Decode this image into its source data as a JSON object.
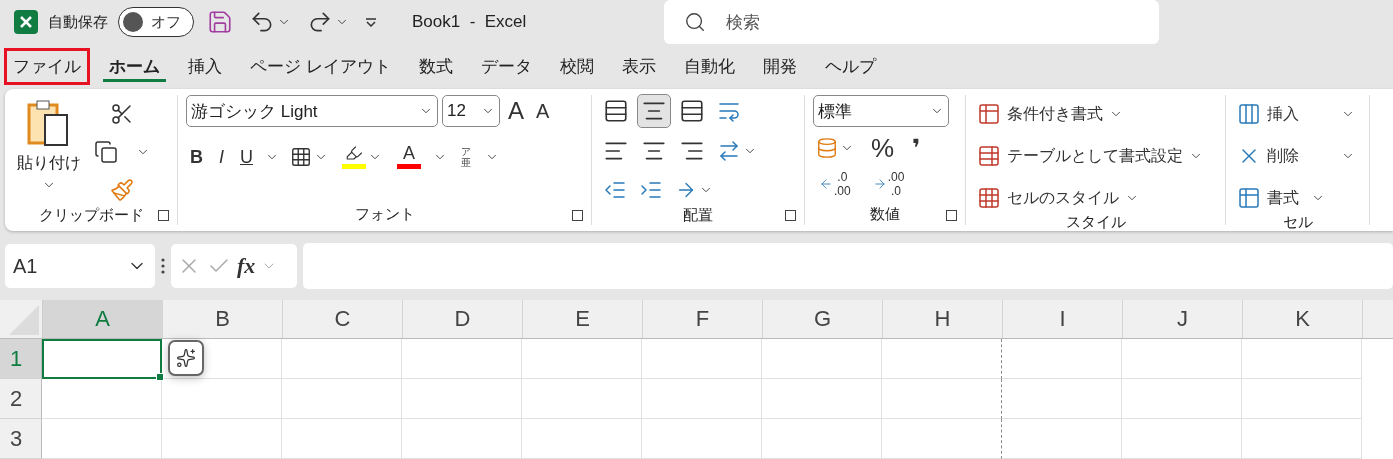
{
  "title_bar": {
    "autosave": {
      "label": "自動保存",
      "on": false,
      "state_label": "オフ"
    },
    "title": "Book1  -  Excel",
    "search": {
      "placeholder": "検索"
    }
  },
  "tabs": [
    {
      "label": "ファイル",
      "selected": false,
      "highlighted": true
    },
    {
      "label": "ホーム",
      "selected": true,
      "highlighted": false
    },
    {
      "label": "挿入",
      "selected": false,
      "highlighted": false
    },
    {
      "label": "ページ レイアウト",
      "selected": false,
      "highlighted": false
    },
    {
      "label": "数式",
      "selected": false,
      "highlighted": false
    },
    {
      "label": "データ",
      "selected": false,
      "highlighted": false
    },
    {
      "label": "校閲",
      "selected": false,
      "highlighted": false
    },
    {
      "label": "表示",
      "selected": false,
      "highlighted": false
    },
    {
      "label": "自動化",
      "selected": false,
      "highlighted": false
    },
    {
      "label": "開発",
      "selected": false,
      "highlighted": false
    },
    {
      "label": "ヘルプ",
      "selected": false,
      "highlighted": false
    }
  ],
  "ribbon": {
    "clipboard": {
      "label": "クリップボード",
      "paste_label": "貼り付け"
    },
    "font": {
      "label": "フォント",
      "font_name": "游ゴシック Light",
      "font_size": "12",
      "grow": "A",
      "shrink": "A",
      "bold": "B",
      "italic": "I",
      "underline": "U",
      "font_color_glyph": "A",
      "phonetic_top": "ア",
      "phonetic_bottom": "亜"
    },
    "alignment": {
      "label": "配置",
      "vertical": [
        {
          "kind": "top",
          "selected": false
        },
        {
          "kind": "middle",
          "selected": true
        },
        {
          "kind": "bottom",
          "selected": false
        }
      ],
      "horizontal": [
        {
          "kind": "left",
          "selected": false
        },
        {
          "kind": "center",
          "selected": false
        },
        {
          "kind": "right",
          "selected": false
        }
      ]
    },
    "number": {
      "label": "数値",
      "format": "標準",
      "percent": "%",
      "comma": "❜",
      "increase_decimal": [
        ".0",
        ".00"
      ],
      "decrease_decimal": [
        ".00",
        ".0"
      ]
    },
    "styles": {
      "label": "スタイル",
      "items": [
        "条件付き書式",
        "テーブルとして書式設定",
        "セルのスタイル"
      ]
    },
    "cells": {
      "label": "セル",
      "items": [
        "挿入",
        "削除",
        "書式"
      ]
    }
  },
  "formula_bar": {
    "name_box": "A1",
    "fx": "fx"
  },
  "grid": {
    "columns": [
      {
        "label": "A",
        "selected": true,
        "page_break_after": false
      },
      {
        "label": "B",
        "selected": false,
        "page_break_after": false
      },
      {
        "label": "C",
        "selected": false,
        "page_break_after": false
      },
      {
        "label": "D",
        "selected": false,
        "page_break_after": false
      },
      {
        "label": "E",
        "selected": false,
        "page_break_after": false
      },
      {
        "label": "F",
        "selected": false,
        "page_break_after": false
      },
      {
        "label": "G",
        "selected": false,
        "page_break_after": false
      },
      {
        "label": "H",
        "selected": false,
        "page_break_after": true
      },
      {
        "label": "I",
        "selected": false,
        "page_break_after": false
      },
      {
        "label": "J",
        "selected": false,
        "page_break_after": false
      },
      {
        "label": "K",
        "selected": false,
        "page_break_after": false
      }
    ],
    "rows": [
      {
        "label": "1",
        "selected": true
      },
      {
        "label": "2",
        "selected": false
      },
      {
        "label": "3",
        "selected": false
      }
    ]
  }
}
